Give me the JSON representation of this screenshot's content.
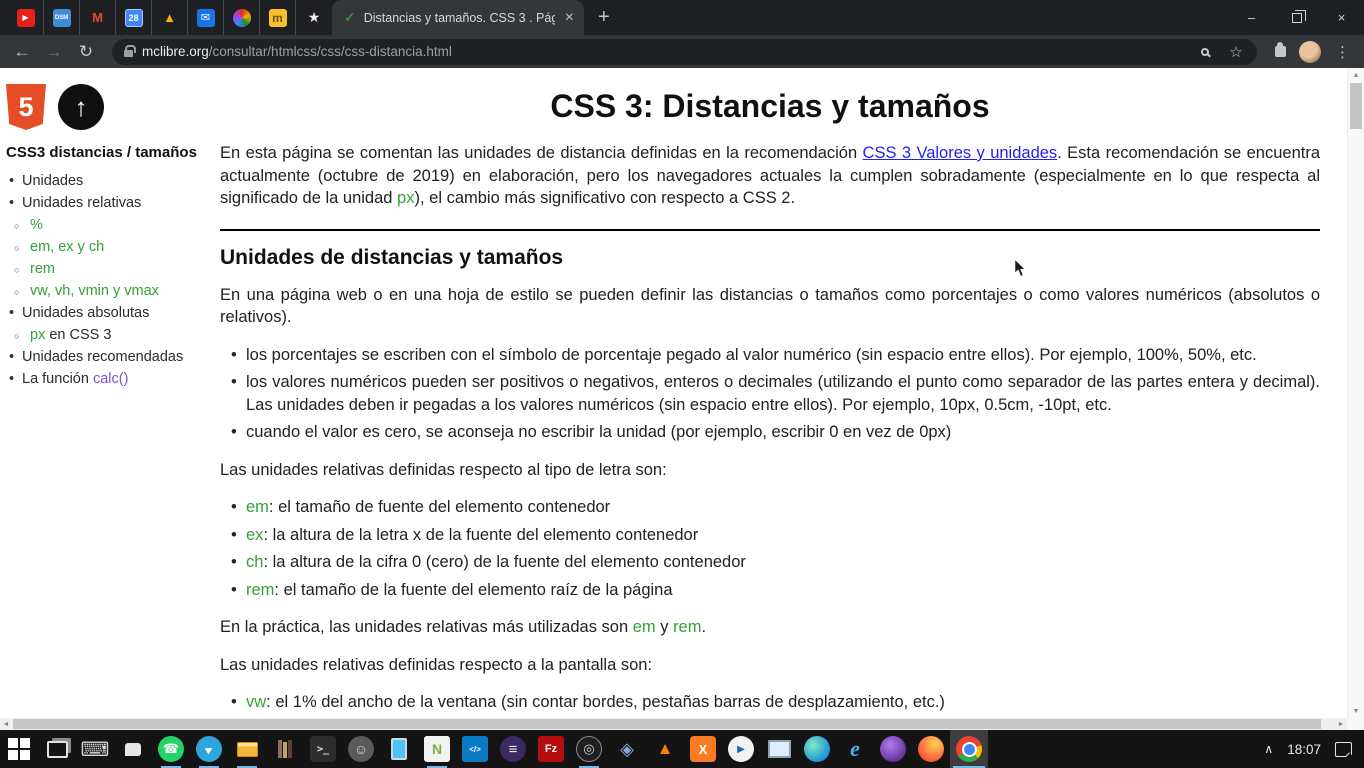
{
  "browser": {
    "pinned_tabs": [
      {
        "name": "youtube"
      },
      {
        "name": "dsm",
        "label": "DSM"
      },
      {
        "name": "gmail",
        "label": "M"
      },
      {
        "name": "calendar",
        "label": "28"
      },
      {
        "name": "drive"
      },
      {
        "name": "mail"
      },
      {
        "name": "community"
      },
      {
        "name": "moodle",
        "label": "m"
      },
      {
        "name": "bookmark-star"
      }
    ],
    "active_tab": {
      "title": "Distancias y tamaños. CSS 3 . Pág",
      "close_glyph": "×",
      "check_glyph": "✓"
    },
    "new_tab_glyph": "+",
    "window_controls": {
      "minimize": "–",
      "close": "×"
    },
    "nav": {
      "back": "←",
      "forward": "→",
      "reload": "↻"
    },
    "address": {
      "host": "mclibre.org",
      "path": "/consultar/htmlcss/css/css-distancia.html"
    }
  },
  "page": {
    "sidebar": {
      "heading": "CSS3 distancias / tamaños",
      "logo_html5": "5",
      "logo_up_arrow": "↑",
      "items": [
        {
          "id": "unidades",
          "level": 1,
          "segments": [
            {
              "text": "Unidades",
              "style": "plain"
            }
          ]
        },
        {
          "id": "unidades-relativas",
          "level": 1,
          "segments": [
            {
              "text": "Unidades relativas",
              "style": "plain"
            }
          ]
        },
        {
          "id": "porcentaje",
          "level": 2,
          "segments": [
            {
              "text": "%",
              "style": "green"
            }
          ]
        },
        {
          "id": "em-ex-ch",
          "level": 2,
          "segments": [
            {
              "text": "em, ex y ch",
              "style": "green"
            }
          ]
        },
        {
          "id": "rem",
          "level": 2,
          "segments": [
            {
              "text": "rem",
              "style": "green"
            }
          ]
        },
        {
          "id": "vw-vh-vmin-vmax",
          "level": 2,
          "segments": [
            {
              "text": "vw, vh, vmin y vmax",
              "style": "green"
            }
          ]
        },
        {
          "id": "unidades-absolutas",
          "level": 1,
          "segments": [
            {
              "text": "Unidades absolutas",
              "style": "plain"
            }
          ]
        },
        {
          "id": "px-en-css3",
          "level": 2,
          "segments": [
            {
              "text": "px",
              "style": "green"
            },
            {
              "text": " en CSS 3",
              "style": "plain"
            }
          ]
        },
        {
          "id": "unidades-recomendadas",
          "level": 1,
          "segments": [
            {
              "text": "Unidades recomendadas",
              "style": "plain"
            }
          ]
        },
        {
          "id": "la-funcion-calc",
          "level": 1,
          "segments": [
            {
              "text": "La función ",
              "style": "plain"
            },
            {
              "text": "calc()",
              "style": "purple"
            }
          ]
        }
      ]
    },
    "main": {
      "title": "CSS 3: Distancias y tamaños",
      "intro": {
        "a": "En esta página se comentan las unidades de distancia definidas en la recomendación ",
        "link": "CSS 3 Valores y unidades",
        "b": ". Esta recomendación se encuentra actualmente (octubre de 2019) en elaboración, pero los navegadores actuales la cumplen sobradamente (especialmente en lo que respecta al significado de la unidad ",
        "unit": "px",
        "c": "), el cambio más significativo con respecto a CSS 2."
      },
      "section_title": "Unidades de distancias y tamaños",
      "p_definir": "En una página web o en una hoja de estilo se pueden definir las distancias o tamaños como porcentajes o como valores numéricos (absolutos o relativos).",
      "rules": [
        "los porcentajes se escriben con el símbolo de porcentaje pegado al valor numérico (sin espacio entre ellos). Por ejemplo, 100%, 50%, etc.",
        "los valores numéricos pueden ser positivos o negativos, enteros o decimales (utilizando el punto como separador de las partes entera y decimal). Las unidades deben ir pegadas a los valores numéricos (sin espacio entre ellos). Por ejemplo, 10px, 0.5cm, -10pt, etc.",
        "cuando el valor es cero, se aconseja no escribir la unidad (por ejemplo, escribir 0 en vez de 0px)"
      ],
      "p_letra": "Las unidades relativas definidas respecto al tipo de letra son:",
      "font_units": [
        {
          "unit": "em",
          "desc": ": el tamaño de fuente del elemento contenedor"
        },
        {
          "unit": "ex",
          "desc": ": la altura de la letra x de la fuente del elemento contenedor"
        },
        {
          "unit": "ch",
          "desc": ": la altura de la cifra 0 (cero) de la fuente del elemento contenedor"
        },
        {
          "unit": "rem",
          "desc": ": el tamaño de la fuente del elemento raíz de la página"
        }
      ],
      "practice": {
        "a": "En la práctica, las unidades relativas más utilizadas son ",
        "em": "em",
        "y": " y ",
        "rem": "rem",
        "dot": "."
      },
      "p_pantalla": "Las unidades relativas definidas respecto a la pantalla son:",
      "screen_units": [
        {
          "unit": "vw",
          "desc": ": el 1% del ancho de la ventana (sin contar bordes, pestañas barras de desplazamiento, etc.)"
        }
      ]
    },
    "colors": {
      "accent_green": "#34a234",
      "link_blue": "#2222ee",
      "visited_purple": "#7a52cc"
    }
  },
  "taskbar": {
    "time": "18:07",
    "chevron": "∧",
    "icons": [
      {
        "name": "start"
      },
      {
        "name": "task-view"
      },
      {
        "name": "touch-keyboard"
      },
      {
        "name": "chat-app"
      },
      {
        "name": "whatsapp",
        "running": true
      },
      {
        "name": "telegram",
        "running": true
      },
      {
        "name": "file-explorer",
        "running": true
      },
      {
        "name": "calibre"
      },
      {
        "name": "powershell"
      },
      {
        "name": "monkey-app"
      },
      {
        "name": "your-phone"
      },
      {
        "name": "notepad-plus-plus",
        "running": true
      },
      {
        "name": "vscode"
      },
      {
        "name": "eclipse"
      },
      {
        "name": "filezilla"
      },
      {
        "name": "obs-studio",
        "running": true
      },
      {
        "name": "virtualbox"
      },
      {
        "name": "vlc"
      },
      {
        "name": "xampp"
      },
      {
        "name": "media-player"
      },
      {
        "name": "system-monitor"
      },
      {
        "name": "globe-app"
      },
      {
        "name": "internet-explorer"
      },
      {
        "name": "purple-app"
      },
      {
        "name": "firefox"
      },
      {
        "name": "chrome",
        "running": true,
        "active": true
      }
    ]
  }
}
